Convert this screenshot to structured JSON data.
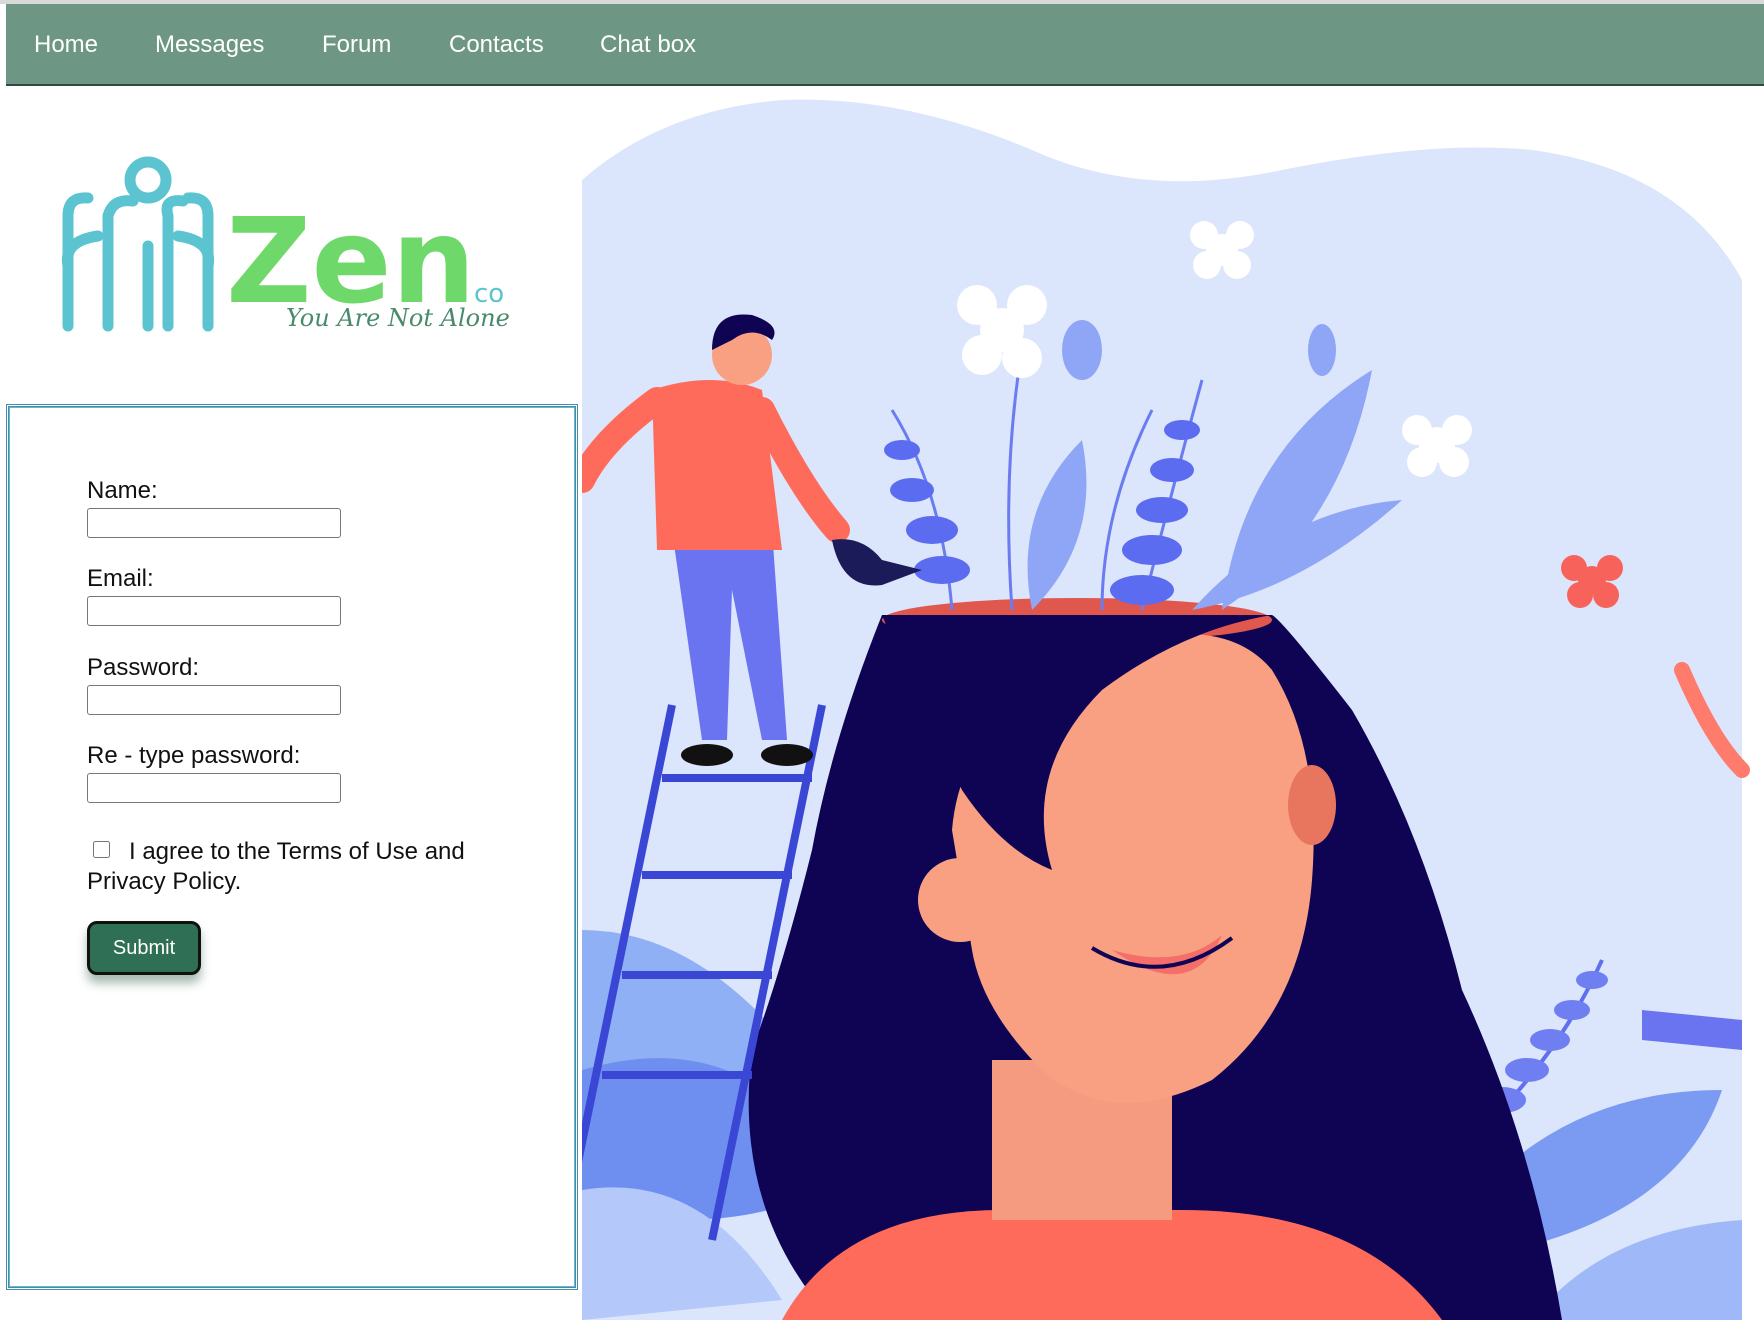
{
  "nav": {
    "items": [
      {
        "label": "Home"
      },
      {
        "label": "Messages"
      },
      {
        "label": "Forum"
      },
      {
        "label": "Contacts"
      },
      {
        "label": "Chat box"
      }
    ]
  },
  "logo": {
    "brand": "Zen",
    "suffix": "co",
    "tagline": "You Are Not Alone"
  },
  "form": {
    "name_label": "Name:",
    "email_label": "Email:",
    "password_label": "Password:",
    "retype_label": "Re - type password:",
    "agree_text": "I agree to the Terms of Use and Privacy Policy.",
    "submit_label": "Submit"
  },
  "colors": {
    "nav_bg": "#6d9784",
    "button_bg": "#2f6f55",
    "form_border": "#3f8eaa",
    "logo_teal": "#5cc4d0",
    "logo_green": "#6fd86a"
  }
}
